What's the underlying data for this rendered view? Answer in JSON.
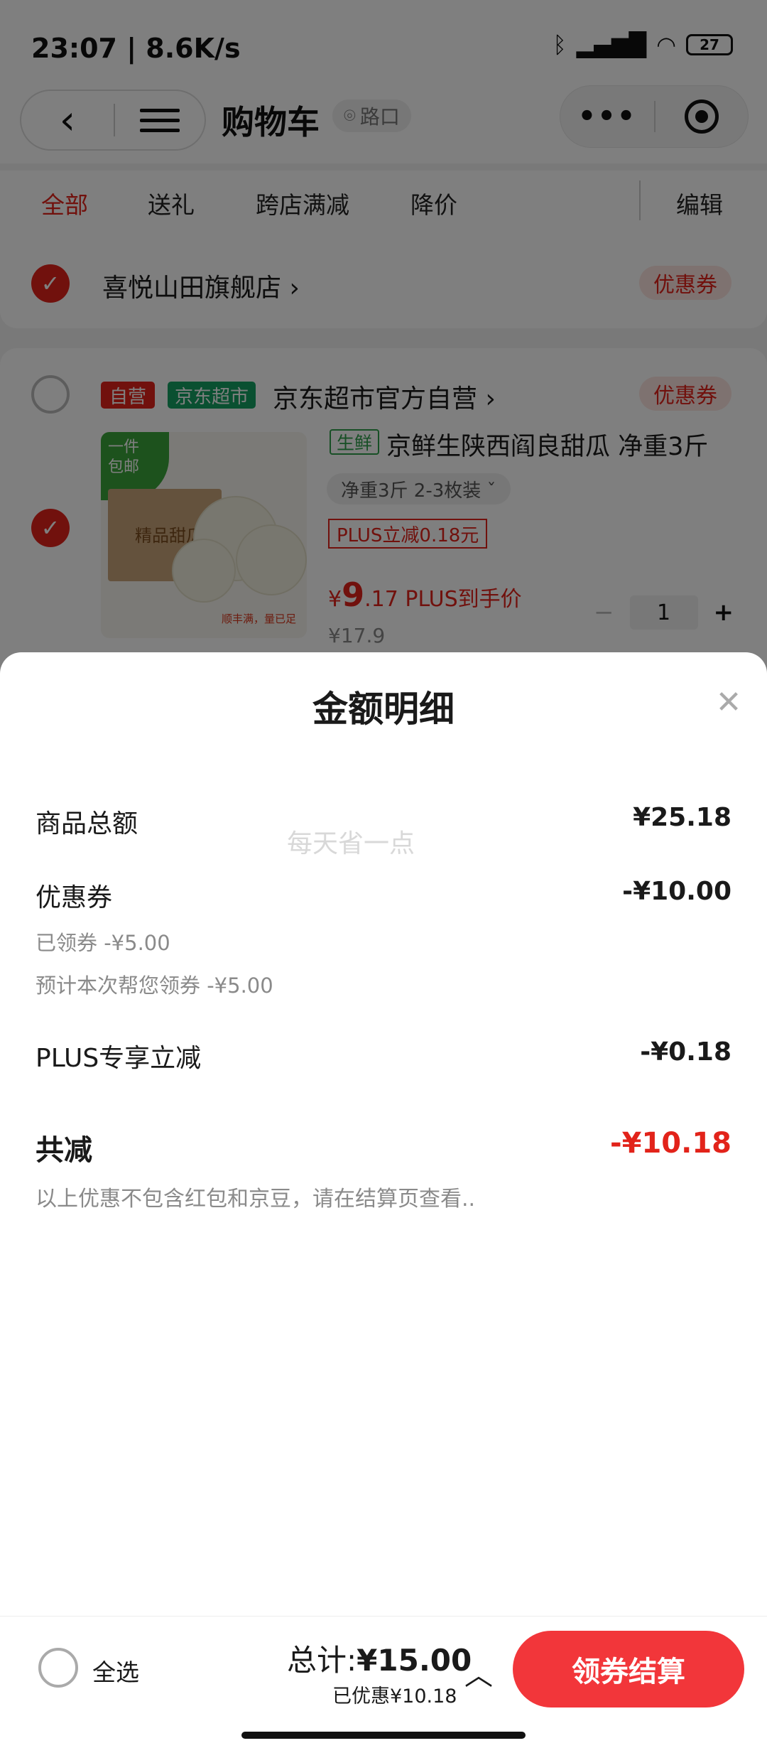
{
  "status_bar": {
    "time_speed": "23:07 | 8.6K/s",
    "battery": "27"
  },
  "nav": {
    "title": "购物车",
    "location": "路口"
  },
  "tabs": [
    "全部",
    "送礼",
    "跨店满减",
    "降价"
  ],
  "edit_label": "编辑",
  "stores": [
    {
      "name": "喜悦山田旗舰店 ›",
      "coupon": "优惠券"
    },
    {
      "name": "京东超市官方自营 ›",
      "coupon": "优惠券",
      "badges": [
        "自营",
        "京东超市"
      ]
    }
  ],
  "product": {
    "fresh_tag": "生鲜",
    "title": "京鲜生陕西阎良甜瓜 净重3斤",
    "spec": "净重3斤 2-3枚装 ˇ",
    "plus_tag": "PLUS立减0.18元",
    "price_symbol": "¥",
    "price_int": "9",
    "price_dec": ".17 PLUS到手价",
    "price_old": "¥17.9",
    "quantity": "1",
    "image": {
      "ribbon": "一件\n包邮",
      "box_label": "精品甜瓜",
      "caption": "顺丰满，量已足"
    }
  },
  "sheet": {
    "title": "金额明细",
    "watermark": "每天省一点",
    "rows": {
      "goods_total": {
        "label": "商品总额",
        "value": "¥25.18"
      },
      "coupon": {
        "label": "优惠券",
        "value": "-¥10.00"
      },
      "coupon_sub1": "已领券 -¥5.00",
      "coupon_sub2": "预计本次帮您领券 -¥5.00",
      "plus": {
        "label": "PLUS专享立减",
        "value": "-¥0.18"
      }
    },
    "total": {
      "label": "共减",
      "value": "-¥10.18"
    },
    "note": "以上优惠不包含红包和京豆，请在结算页查看.."
  },
  "bottom": {
    "select_all": "全选",
    "total_label": "总计:",
    "total_value": "¥15.00",
    "saved": "已优惠¥10.18",
    "checkout": "领券结算"
  },
  "colors": {
    "accent": "#e2231a",
    "checkout": "#f2363a",
    "jd_green": "#14a062"
  }
}
